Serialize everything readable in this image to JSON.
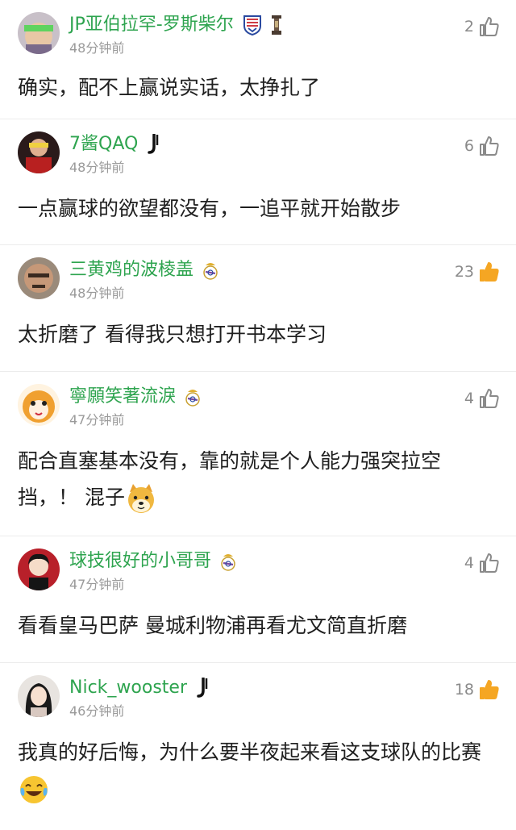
{
  "colors": {
    "username": "#2ea44f",
    "timestamp": "#9a9a9a",
    "like_active": "#f5a623",
    "like_inactive": "#8a8a8a",
    "divider": "#ececec"
  },
  "comments": [
    {
      "username": "JP亚伯拉罕-罗斯柴尔",
      "badges": [
        "shenhua-crest-icon",
        "trophy-icon"
      ],
      "time": "48分钟前",
      "likes": "2",
      "liked": false,
      "text": "确实，配不上赢说实话，太挣扎了",
      "emoji": ""
    },
    {
      "username": "7酱QAQ",
      "badges": [
        "juventus-logo-icon"
      ],
      "time": "48分钟前",
      "likes": "6",
      "liked": false,
      "text": "一点赢球的欲望都没有，一追平就开始散步",
      "emoji": ""
    },
    {
      "username": "三黄鸡的波棱盖",
      "badges": [
        "real-madrid-crest-icon"
      ],
      "time": "48分钟前",
      "likes": "23",
      "liked": true,
      "text": "太折磨了 看得我只想打开书本学习",
      "emoji": ""
    },
    {
      "username": "寧願笑著流淚",
      "badges": [
        "real-madrid-crest-icon"
      ],
      "time": "47分钟前",
      "likes": "4",
      "liked": false,
      "text": "配合直塞基本没有，靠的就是个人能力强突拉空挡，！ 混子",
      "emoji": "doge-emoji"
    },
    {
      "username": "球技很好的小哥哥",
      "badges": [
        "real-madrid-crest-icon"
      ],
      "time": "47分钟前",
      "likes": "4",
      "liked": false,
      "text": "看看皇马巴萨 曼城利物浦再看尤文简直折磨",
      "emoji": ""
    },
    {
      "username": "Nick_wooster",
      "badges": [
        "juventus-logo-icon"
      ],
      "time": "46分钟前",
      "likes": "18",
      "liked": true,
      "text": "我真的好后悔，为什么要半夜起来看这支球队的比赛",
      "emoji": "laugh-cry-emoji"
    }
  ]
}
